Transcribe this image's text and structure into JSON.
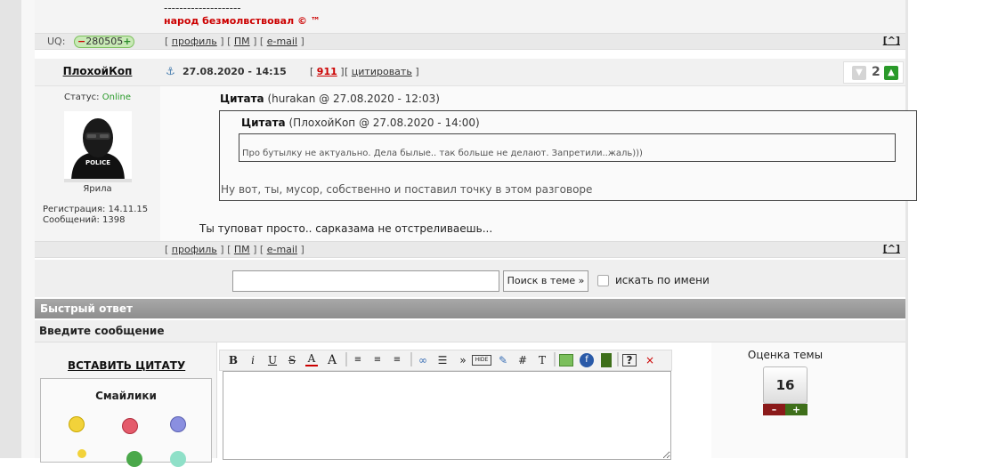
{
  "prev_post": {
    "sig_separator": "--------------------",
    "signature": "народ безмолвствовал © ™",
    "uq_label": "UQ:",
    "uq_value": "280505",
    "links": {
      "profile": "профиль",
      "pm": "ПМ",
      "email": "e-mail"
    },
    "totop": "^"
  },
  "post": {
    "author": "ПлохойКоп",
    "anchor_icon": "anchor-icon",
    "date": "27.08.2020 - 14:15",
    "number": "911",
    "cite_label": "цитировать",
    "rating_count": "2",
    "status_label": "Статус:",
    "status_value": "Online",
    "avatar_text": "POLICE",
    "avatar_caption": "Ярила",
    "registration": "Регистрация: 14.11.15",
    "messages": "Сообщений: 1398",
    "outer_quote_title": "Цитата",
    "outer_quote_meta": "(hurakan @ 27.08.2020 - 12:03)",
    "inner_quote_title": "Цитата",
    "inner_quote_meta": "(ПлохойКоп @ 27.08.2020 - 14:00)",
    "inner_quote_text": "Про бутылку не актуально. Дела былые.. так больше не делают. Запретили..жаль)))",
    "outer_quote_text": "Ну вот, ты, мусор, собственно и поставил точку в этом разговоре",
    "message": "Ты туповат просто.. сарказама не отстреливаешь...",
    "links": {
      "profile": "профиль",
      "pm": "ПМ",
      "email": "e-mail"
    },
    "totop": "^"
  },
  "search": {
    "input_value": "",
    "button_label": "Поиск в теме »",
    "checkbox_label": "искать по имени"
  },
  "quick_reply": {
    "title": "Быстрый ответ",
    "subtitle": "Введите сообщение",
    "insert_quote": "ВСТАВИТЬ ЦИТАТУ",
    "smiles_title": "Смайлики",
    "toolbar": {
      "bold": "B",
      "italic": "i",
      "underline": "U",
      "strike": "S",
      "color": "A",
      "size": "A",
      "link": "∞",
      "quote": "»",
      "hide": "HIDE",
      "hash": "#",
      "font": "T",
      "help": "?",
      "close": "×"
    },
    "rating_label": "Оценка темы",
    "rating_value": "16",
    "rating_minus": "–",
    "rating_plus": "+"
  },
  "colors": {
    "signature": "#cc0000",
    "online": "#2a9a2a",
    "uq_badge_bg": "#c8e9b6",
    "qr_header": "#999999"
  }
}
